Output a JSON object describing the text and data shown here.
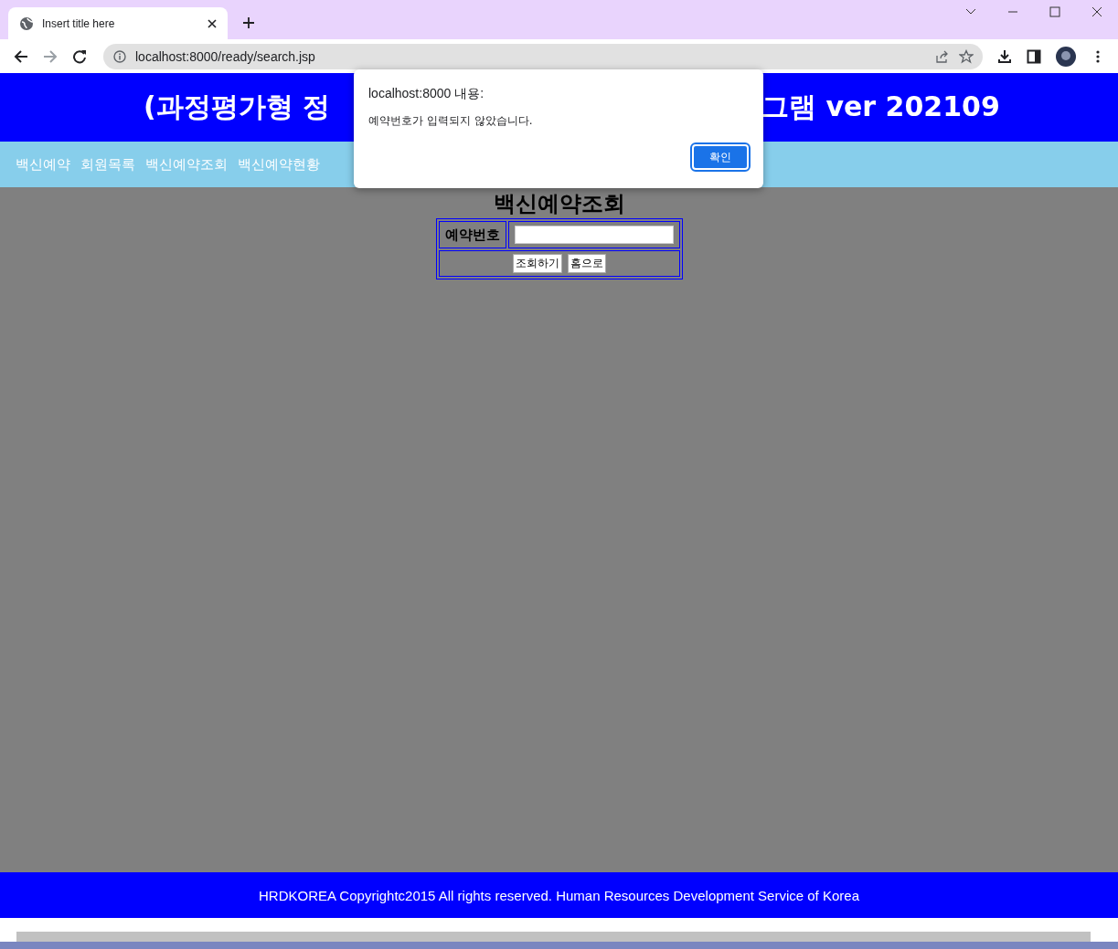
{
  "browser": {
    "tab_title": "Insert title here",
    "address": "localhost:8000/ready/search.jsp"
  },
  "header": {
    "title_left": "(과정평가형 정",
    "title_right": "그램 ver 202109"
  },
  "nav": [
    "백신예약",
    "회원목록",
    "백신예약조회",
    "백신예약현황"
  ],
  "form": {
    "title": "백신예약조회",
    "field_label": "예약번호",
    "buttons": [
      "조회하기",
      "홈으로"
    ]
  },
  "footer": "HRDKOREA Copyrightc2015 All rights reserved. Human Resources Development Service of Korea",
  "dialog": {
    "title": "localhost:8000 내용:",
    "message": "예약번호가 입력되지 않았습니다.",
    "button": "확인"
  }
}
